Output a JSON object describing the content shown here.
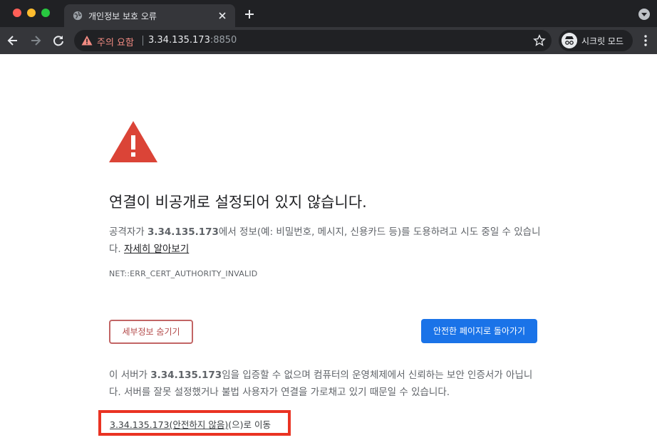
{
  "window": {
    "tab_title": "개인정보 보호 오류"
  },
  "toolbar": {
    "security_chip": "주의 요함",
    "url_host": "3.34.135.173",
    "url_port": ":8850",
    "incognito_label": "시크릿 모드"
  },
  "page": {
    "headline": "연결이 비공개로 설정되어 있지 않습니다.",
    "para1_prefix": "공격자가 ",
    "para1_host": "3.34.135.173",
    "para1_suffix": "에서 정보(예: 비밀번호, 메시지, 신용카드 등)를 도용하려고 시도 중일 수 있습니다. ",
    "learn_more": "자세히 알아보기",
    "error_code": "NET::ERR_CERT_AUTHORITY_INVALID",
    "details_button": "세부정보 숨기기",
    "back_button": "안전한 페이지로 돌아가기",
    "para2_prefix": "이 서버가 ",
    "para2_host": "3.34.135.173",
    "para2_suffix": "임을 입증할 수 없으며 컴퓨터의 운영체제에서 신뢰하는 보안 인증서가 아닙니다. 서버를 잘못 설정했거나 불법 사용자가 연결을 가로채고 있기 때문일 수 있습니다.",
    "proceed_link": "3.34.135.173(안전하지 않음)",
    "proceed_suffix": "(으)로 이동"
  },
  "colors": {
    "chrome_dark": "#202124",
    "toolbar": "#35363a",
    "warning_red": "#db4437",
    "link_blue": "#1a73e8",
    "highlight_red": "#ea3323"
  },
  "icons": [
    "globe-icon",
    "close-icon",
    "plus-icon",
    "back-arrow-icon",
    "forward-arrow-icon",
    "reload-icon",
    "warning-icon",
    "star-icon",
    "incognito-icon",
    "kebab-menu-icon",
    "tab-search-icon"
  ]
}
